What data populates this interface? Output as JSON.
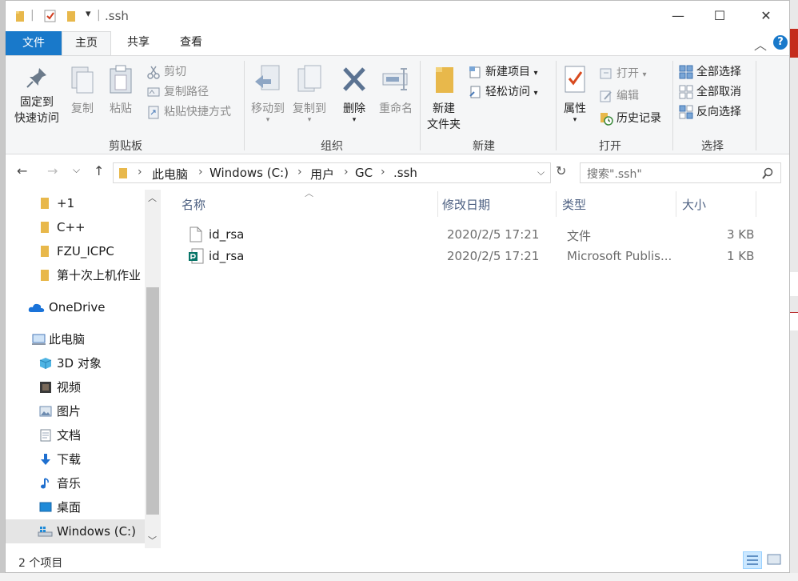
{
  "window": {
    "title": ".ssh",
    "controls": {
      "minimize": "—",
      "maximize": "☐",
      "close": "✕"
    },
    "quick_access_dropdown": "▾",
    "help": "?"
  },
  "tabs": [
    {
      "label": "文件"
    },
    {
      "label": "主页"
    },
    {
      "label": "共享"
    },
    {
      "label": "查看"
    }
  ],
  "ribbon": {
    "clipboard": {
      "pin_label": "固定到\n快速访问",
      "pin_line1": "固定到",
      "pin_line2": "快速访问",
      "copy": "复制",
      "paste": "粘贴",
      "cut": "剪切",
      "copy_path": "复制路径",
      "paste_shortcut": "粘贴快捷方式",
      "group": "剪贴板"
    },
    "organize": {
      "move_to": "移动到",
      "copy_to": "复制到",
      "delete": "删除",
      "rename": "重命名",
      "group": "组织"
    },
    "new": {
      "new_folder_line1": "新建",
      "new_folder_line2": "文件夹",
      "new_item": "新建项目",
      "easy_access": "轻松访问",
      "group": "新建"
    },
    "open": {
      "properties": "属性",
      "open": "打开",
      "edit": "编辑",
      "history": "历史记录",
      "group": "打开"
    },
    "select": {
      "select_all": "全部选择",
      "select_none": "全部取消",
      "invert": "反向选择",
      "group": "选择"
    }
  },
  "address": {
    "breadcrumbs": [
      "此电脑",
      "Windows  (C:)",
      "用户",
      "GC",
      ".ssh"
    ],
    "search_placeholder": "搜索\".ssh\""
  },
  "nav": {
    "items": [
      {
        "label": "+1",
        "icon": "folder-icon"
      },
      {
        "label": "C++",
        "icon": "folder-icon"
      },
      {
        "label": "FZU_ICPC",
        "icon": "folder-icon"
      },
      {
        "label": "第十次上机作业",
        "icon": "folder-icon"
      },
      {
        "label": "OneDrive",
        "icon": "cloud-icon"
      },
      {
        "label": "此电脑",
        "icon": "computer-icon"
      },
      {
        "label": "3D 对象",
        "icon": "cube-icon"
      },
      {
        "label": "视频",
        "icon": "video-icon"
      },
      {
        "label": "图片",
        "icon": "picture-icon"
      },
      {
        "label": "文档",
        "icon": "document-icon"
      },
      {
        "label": "下载",
        "icon": "download-icon"
      },
      {
        "label": "音乐",
        "icon": "music-icon"
      },
      {
        "label": "桌面",
        "icon": "desktop-icon"
      },
      {
        "label": "Windows  (C:)",
        "icon": "drive-icon"
      }
    ]
  },
  "list": {
    "columns": [
      "名称",
      "修改日期",
      "类型",
      "大小"
    ],
    "rows": [
      {
        "name": "id_rsa",
        "date": "2020/2/5 17:21",
        "type": "文件",
        "size": "3 KB",
        "icon": "file-icon"
      },
      {
        "name": "id_rsa",
        "date": "2020/2/5 17:21",
        "type": "Microsoft Publis...",
        "size": "1 KB",
        "icon": "publisher-icon"
      }
    ]
  },
  "status": {
    "count": "2 个项目"
  },
  "colors": {
    "accent": "#1979ca",
    "folder": "#e8b84b",
    "ribbon_bg": "#f5f6f7",
    "selected_nav": "#e5e5e5"
  }
}
